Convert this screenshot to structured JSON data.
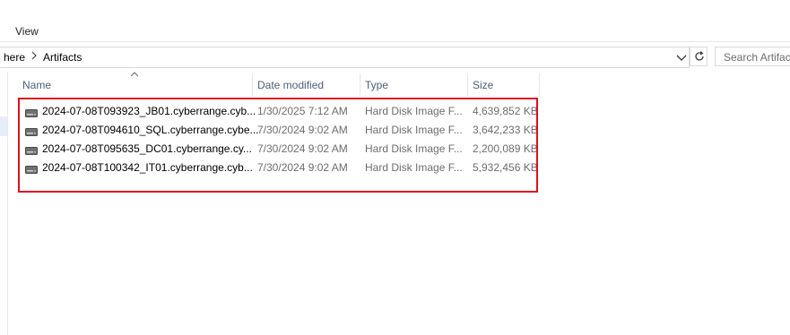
{
  "ribbon": {
    "view_tab": "View"
  },
  "address": {
    "crumbs": [
      "here",
      "Artifacts"
    ],
    "search_placeholder": "Search Artifacts"
  },
  "columns": {
    "name": "Name",
    "date": "Date modified",
    "type": "Type",
    "size": "Size"
  },
  "files": [
    {
      "name": "2024-07-08T093923_JB01.cyberrange.cyb...",
      "date": "1/30/2025 7:12 AM",
      "type": "Hard Disk Image F...",
      "size": "4,639,852 KB"
    },
    {
      "name": "2024-07-08T094610_SQL.cyberrange.cybe...",
      "date": "7/30/2024 9:02 AM",
      "type": "Hard Disk Image F...",
      "size": "3,642,233 KB"
    },
    {
      "name": "2024-07-08T095635_DC01.cyberrange.cy...",
      "date": "7/30/2024 9:02 AM",
      "type": "Hard Disk Image F...",
      "size": "2,200,089 KB"
    },
    {
      "name": "2024-07-08T100342_IT01.cyberrange.cyb...",
      "date": "7/30/2024 9:02 AM",
      "type": "Hard Disk Image F...",
      "size": "5,932,456 KB"
    }
  ],
  "colors": {
    "highlight": "#e0101c",
    "header_text": "#4c607a",
    "meta_text": "#6d6d6d"
  },
  "icons": [
    "disk-image-icon",
    "chevron-right-icon",
    "chevron-down-icon",
    "refresh-icon",
    "sort-up-icon"
  ]
}
